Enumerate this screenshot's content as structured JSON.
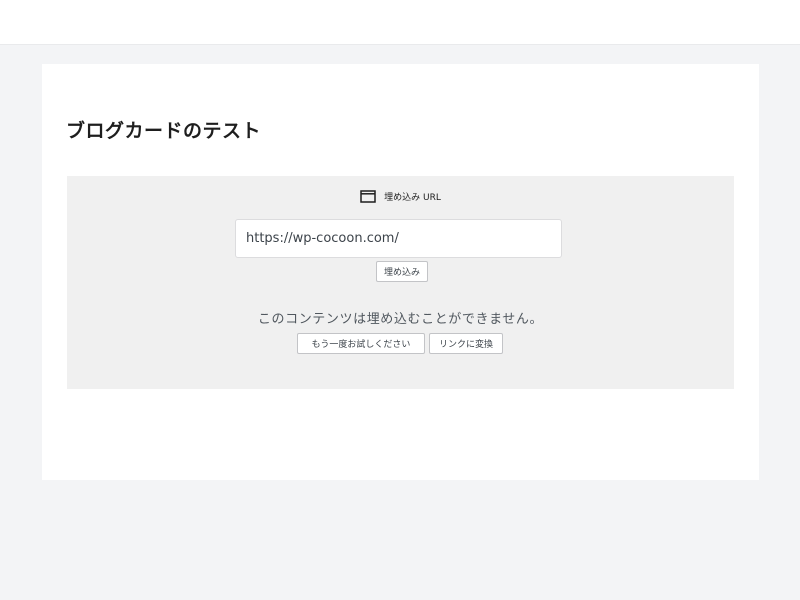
{
  "post": {
    "title": "ブログカードのテスト"
  },
  "embed": {
    "label": "埋め込み URL",
    "icon": "embed-frame-icon",
    "url_value": "https://wp-cocoon.com/",
    "submit_label": "埋め込み",
    "error_message": "このコンテンツは埋め込むことができません。",
    "retry_label": "もう一度お試しください",
    "convert_label": "リンクに変換"
  },
  "colors": {
    "page_background": "#f3f4f6",
    "card_background": "#ffffff",
    "embed_background": "#f0f0f0",
    "text": "#1e1e1e",
    "muted_text": "#50575e"
  }
}
